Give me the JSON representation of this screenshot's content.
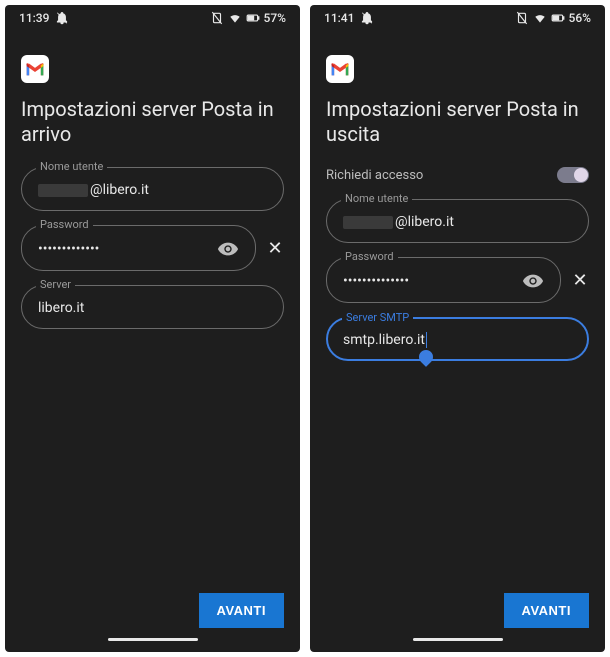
{
  "left": {
    "status": {
      "time": "11:39",
      "battery": "57%"
    },
    "title": "Impostazioni server Posta in arrivo",
    "fields": {
      "username_label": "Nome utente",
      "username_suffix": "@libero.it",
      "password_label": "Password",
      "password_value": "•••••••••••••",
      "server_label": "Server",
      "server_value": "libero.it"
    },
    "next_button": "AVANTI"
  },
  "right": {
    "status": {
      "time": "11:41",
      "battery": "56%"
    },
    "title": "Impostazioni server Posta in uscita",
    "toggle_label": "Richiedi accesso",
    "fields": {
      "username_label": "Nome utente",
      "username_suffix": "@libero.it",
      "password_label": "Password",
      "password_value": "••••••••••••••",
      "smtp_label": "Server SMTP",
      "smtp_value": "smtp.libero.it"
    },
    "next_button": "AVANTI"
  }
}
